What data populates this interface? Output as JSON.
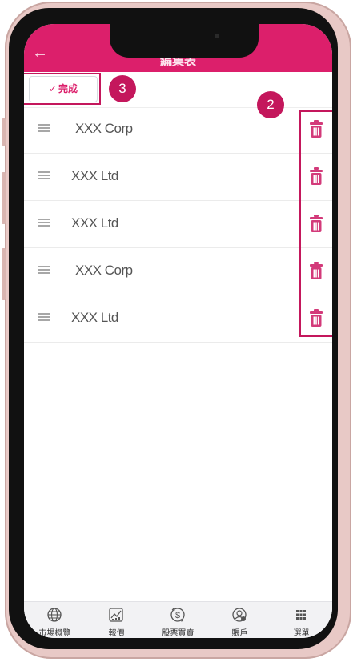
{
  "header": {
    "title": "編集表"
  },
  "toolbar": {
    "done_label": "完成",
    "check_glyph": "✓"
  },
  "annotations": {
    "step_done": "3",
    "step_delete": "2"
  },
  "watchlist": [
    {
      "name": "XXX Corp",
      "icon": "drag-handle-icon",
      "action_icon": "trash-icon"
    },
    {
      "name": "XXX Ltd",
      "icon": "drag-handle-icon",
      "action_icon": "trash-icon"
    },
    {
      "name": "XXX Ltd",
      "icon": "drag-handle-icon",
      "action_icon": "trash-icon"
    },
    {
      "name": "XXX Corp",
      "icon": "drag-handle-icon",
      "action_icon": "trash-icon"
    },
    {
      "name": "XXX Ltd",
      "icon": "drag-handle-icon",
      "action_icon": "trash-icon"
    }
  ],
  "tabbar": {
    "tabs": [
      {
        "label": "市場概覽",
        "icon": "globe-icon"
      },
      {
        "label": "報價",
        "icon": "chart-icon"
      },
      {
        "label": "股票買賣",
        "icon": "dollar-icon"
      },
      {
        "label": "賬戶",
        "icon": "account-icon"
      },
      {
        "label": "選單",
        "icon": "grid-menu-icon"
      }
    ]
  },
  "colors": {
    "brand": "#dc1f6b",
    "highlight": "#c4175c",
    "trash": "#d33a7a",
    "frame": "#e8c9c6"
  }
}
